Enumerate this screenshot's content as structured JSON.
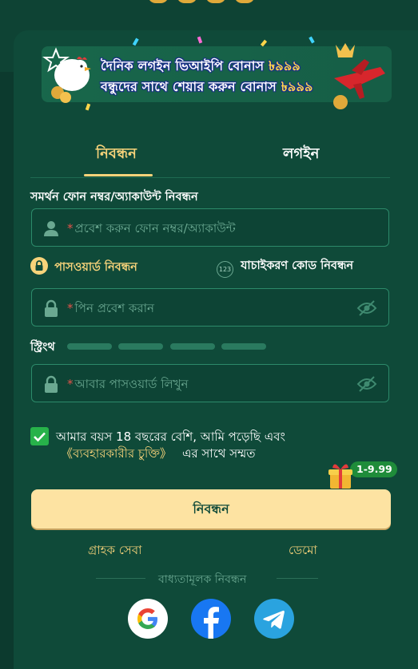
{
  "banner": {
    "line1_text": "দৈনিক লগইন ভিআইপি বোনাস ",
    "line1_amount": "৳৯৯৯",
    "line2_text": "বন্ধুদের সাথে শেয়ার করুন বোনাস ",
    "line2_amount": "৳৯৯৯"
  },
  "tabs": [
    {
      "label": "নিবন্ধন",
      "active": true
    },
    {
      "label": "লগইন",
      "active": false
    }
  ],
  "form": {
    "section_title": "সমর্থন ফোন নম্বর/অ্যাকাউন্ট নিবন্ধন",
    "account_placeholder": "প্রবেশ করুন ফোন নম্বর/অ্যাকাউন্ট",
    "password_mode_label": "পাসওয়ার্ড নিবন্ধন",
    "code_mode_label": "যাচাইকরণ কোড নিবন্ধন",
    "code_icon_text": "123",
    "pin_placeholder": "পিন প্রবেশ করান",
    "strength_label": "স্ট্রিংথ",
    "confirm_placeholder": "আবার পাসওয়ার্ড লিখুন",
    "required_mark": "*"
  },
  "agreement": {
    "checked": true,
    "text_part1": "আমার বয়স 18 বছরের বেশি, আমি পড়েছি এবং",
    "link_text": "《ব্যবহারকারীর চুক্তি》",
    "text_part2": "এর সাথে সম্মত"
  },
  "gift_badge": "1-9.99",
  "submit_label": "নিবন্ধন",
  "footer": {
    "customer_service": "গ্রাহক সেবা",
    "demo": "ডেমো",
    "divider_text": "বাধ্যতামূলক নিবন্ধন"
  },
  "social": [
    {
      "name": "google-icon"
    },
    {
      "name": "facebook-icon"
    },
    {
      "name": "telegram-icon"
    }
  ],
  "colors": {
    "background": "#0c3a2e",
    "panel": "#0f4a39",
    "accent_gold": "#f7d37a",
    "submit_bg": "#fde3a2",
    "checkbox_green": "#27b24a",
    "facebook_blue": "#1877f2",
    "telegram_blue": "#2aa3df"
  }
}
